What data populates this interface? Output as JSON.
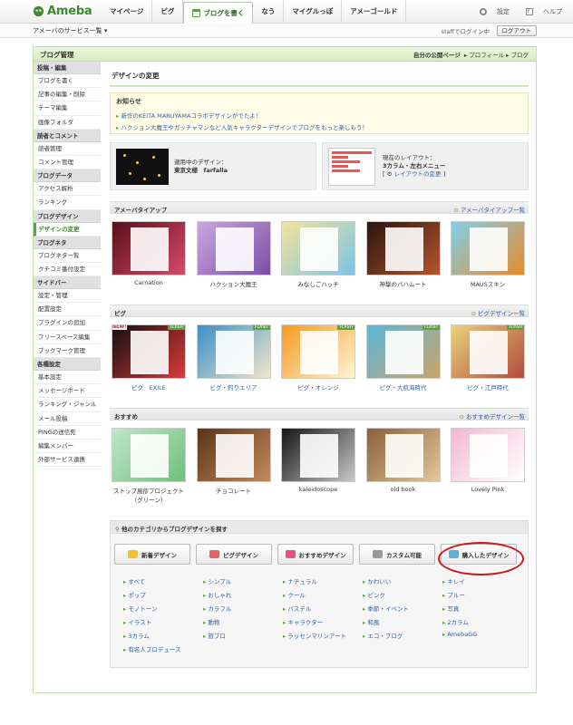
{
  "header": {
    "logo": "Ameba",
    "nav": [
      "マイページ",
      "ピグ",
      "ブログを書く",
      "なう",
      "マイグルっぽ",
      "アメーゴールド"
    ],
    "active_nav": "ブログを書く",
    "settings": "設定",
    "help": "ヘルプ"
  },
  "subbar": {
    "services": "アメーバのサービス一覧",
    "login_status": "staffでログイン中",
    "logout": "ログアウト"
  },
  "panel": {
    "title": "ブログ管理",
    "links": [
      "自分の公開ページ",
      "プロフィール",
      "ブログ"
    ]
  },
  "sidebar": {
    "sections": [
      {
        "head": "投稿・編集",
        "items": [
          "ブログを書く",
          "記事の編集・削除",
          "テーマ編集",
          "画像フォルダ"
        ]
      },
      {
        "head": "読者とコメント",
        "items": [
          "読者管理",
          "コメント管理"
        ]
      },
      {
        "head": "ブログデータ",
        "items": [
          "アクセス解析",
          "ランキング"
        ]
      },
      {
        "head": "ブログデザイン",
        "items": [
          "デザインの変更"
        ]
      },
      {
        "head": "ブログネタ",
        "items": [
          "ブログネタ一覧",
          "クチコミ番付設定"
        ]
      },
      {
        "head": "サイドバー",
        "items": [
          "設定・管理",
          "配置設定",
          "プラグインの追加",
          "フリースペース編集",
          "ブックマーク管理"
        ]
      },
      {
        "head": "各種設定",
        "items": [
          "基本設定",
          "メッセージボード",
          "ランキング・ジャンル",
          "メール投稿",
          "PINGの送信先",
          "編集メンバー",
          "外部サービス連携"
        ]
      }
    ],
    "active": "デザインの変更"
  },
  "main": {
    "title": "デザインの変更",
    "notice": {
      "title": "お知らせ",
      "lines": [
        "新作のKEITA MARUYAMAコラボデザインがでたよ！",
        "ハクション大魔王やガッチャマンなど人気キャラクターデザインでブログをもっと楽しもう！"
      ]
    },
    "current_design": {
      "label": "適用中のデザイン：",
      "value": "東京文様　farfalla"
    },
    "current_layout": {
      "label": "現在のレイアウト：",
      "value": "3カラム・左右メニュー",
      "link": "レイアウトの変更"
    },
    "sections": [
      {
        "title": "アメーバタイアップ",
        "link": "アメーバタイアップ一覧",
        "items": [
          {
            "label": "Carnation",
            "bg": "#5a0f1c",
            "accent": "#d94a6a"
          },
          {
            "label": "ハクション大魔王",
            "bg": "#c9a7e0",
            "accent": "#7b4fa8"
          },
          {
            "label": "みなしごハッチ",
            "bg": "#f3e39a",
            "accent": "#7cc4e6"
          },
          {
            "label": "神撃のバハムート",
            "bg": "#2a1410",
            "accent": "#b5562a"
          },
          {
            "label": "MAUSスキン",
            "bg": "#7fd0ec",
            "accent": "#e88a2a"
          }
        ]
      },
      {
        "title": "ピグ",
        "link": "ピグデザイン一覧",
        "items": [
          {
            "label": "ピグ　EXILE",
            "bg": "#101010",
            "accent": "#e03a3a",
            "badge": "NEW!",
            "flash": "FLASH"
          },
          {
            "label": "ピグ・釣りエリア",
            "bg": "#3a8fc9",
            "accent": "#f2e6c8",
            "flash": "FLASH"
          },
          {
            "label": "ピグ・オレンジ",
            "bg": "#f59a1e",
            "accent": "#fff3d6",
            "flash": "FLASH"
          },
          {
            "label": "ピグ・大航海時代",
            "bg": "#5ab7d8",
            "accent": "#caa46a",
            "flash": "FLASH"
          },
          {
            "label": "ピグ・江戸時代",
            "bg": "#e9d27a",
            "accent": "#b24a3a",
            "flash": "FLASH"
          }
        ]
      },
      {
        "title": "おすすめ",
        "link": "おすすめデザイン一覧",
        "items": [
          {
            "label": "ストップ風疹プロジェクト（グリーン）",
            "bg": "#bfe6c9",
            "accent": "#6fbf7a"
          },
          {
            "label": "チョコレート",
            "bg": "#5a3418",
            "accent": "#c48a5a"
          },
          {
            "label": "kaleidoscope",
            "bg": "#151515",
            "accent": "#c8c8c8"
          },
          {
            "label": "old book",
            "bg": "#8a6038",
            "accent": "#e2c79a"
          },
          {
            "label": "Lovely Pink",
            "bg": "#f3b8d2",
            "accent": "#ffffff"
          }
        ]
      }
    ],
    "category_search": {
      "title": "他のカテゴリからブログデザインを探す",
      "buttons": [
        {
          "label": "新着デザイン",
          "icon": "new-star-icon",
          "color": "#f2c230"
        },
        {
          "label": "ピグデザイン",
          "icon": "pigg-avatar-icon",
          "color": "#e86060"
        },
        {
          "label": "おすすめデザイン",
          "icon": "heart-icon",
          "color": "#e8508a"
        },
        {
          "label": "カスタム可能",
          "icon": "wrench-icon",
          "color": "#999999"
        },
        {
          "label": "購入したデザイン",
          "icon": "shopping-bag-icon",
          "color": "#5ab0d8"
        }
      ],
      "links": [
        "すべて",
        "シンプル",
        "ナチュラル",
        "かわいい",
        "キレイ",
        "ポップ",
        "おしゃれ",
        "クール",
        "ピンク",
        "ブルー",
        "モノトーン",
        "カラフル",
        "パステル",
        "季節・イベント",
        "写真",
        "イラスト",
        "動物",
        "キャラクター",
        "和風",
        "2カラム",
        "3カラム",
        "旅ブロ",
        "ラッセンマリンアート",
        "エコ・ブログ",
        "AmebaGG",
        "有名人プロデュース"
      ]
    }
  }
}
